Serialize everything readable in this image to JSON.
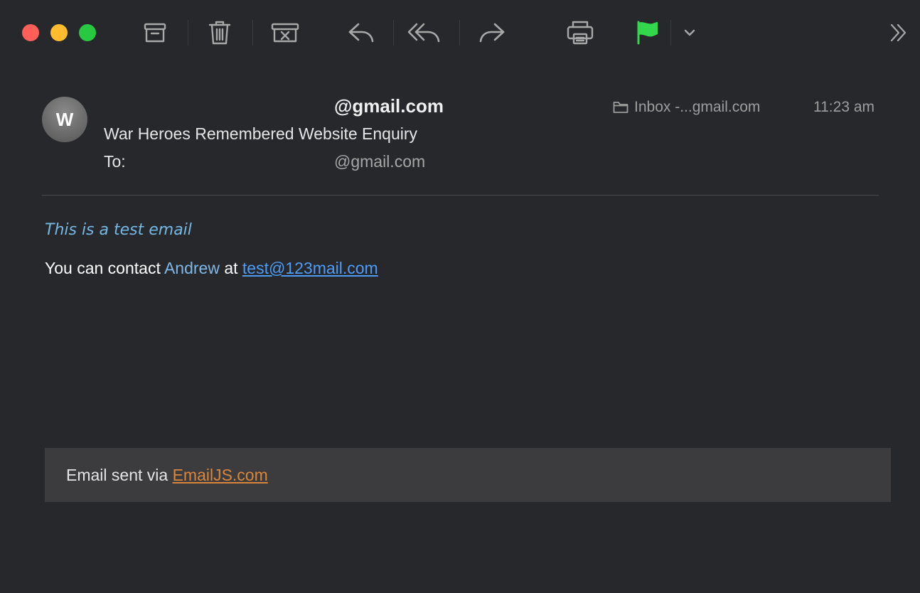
{
  "toolbar": {
    "buttons": [
      {
        "name": "archive",
        "icon": "archive-icon"
      },
      {
        "name": "delete",
        "icon": "trash-icon"
      },
      {
        "name": "junk",
        "icon": "junk-icon"
      },
      {
        "name": "reply",
        "icon": "reply-icon"
      },
      {
        "name": "reply-all",
        "icon": "reply-all-icon"
      },
      {
        "name": "forward",
        "icon": "forward-icon"
      },
      {
        "name": "print",
        "icon": "printer-icon"
      },
      {
        "name": "flag",
        "icon": "flag-icon"
      },
      {
        "name": "flag-menu",
        "icon": "chevron-down-icon"
      },
      {
        "name": "more",
        "icon": "double-chevron-right-icon"
      }
    ],
    "flag_color": "#32d74b"
  },
  "message": {
    "avatar_initial": "W",
    "from": "@gmail.com",
    "subject": "War Heroes Remembered Website Enquiry",
    "to_label": "To:",
    "to_value": "@gmail.com",
    "mailbox": "Inbox -...gmail.com",
    "time": "11:23 am"
  },
  "body": {
    "italic_line": "This is a test email",
    "contact_prefix": "You can contact ",
    "contact_name": "Andrew",
    "contact_middle": " at ",
    "contact_email": "test@123mail.com"
  },
  "footer": {
    "prefix": "Email sent via ",
    "link": "EmailJS.com"
  },
  "colors": {
    "background": "#27282b",
    "link_blue": "#4d9cf8",
    "italic_blue": "#74b9e6",
    "footer_link": "#d9863a"
  }
}
